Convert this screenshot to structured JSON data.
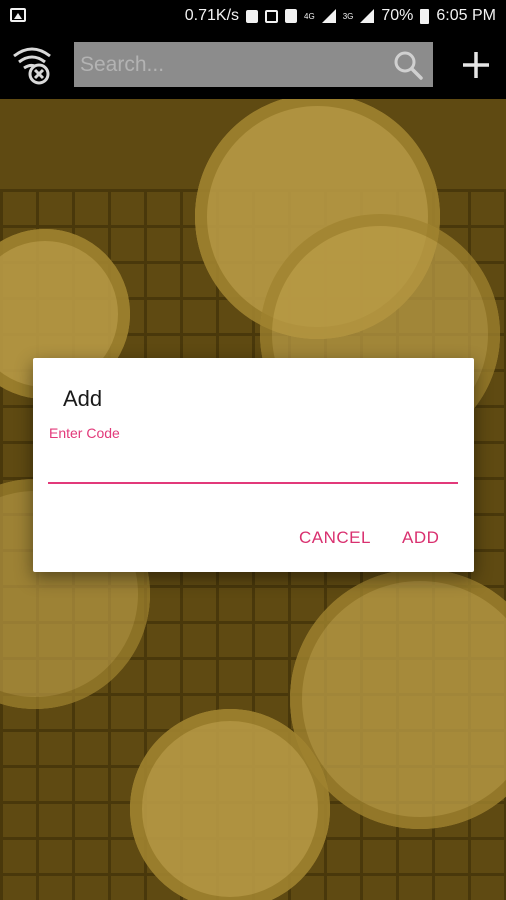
{
  "status_bar": {
    "speed": "0.71K/s",
    "network_labels": [
      "4G",
      "3G"
    ],
    "battery": "70%",
    "time": "6:05 PM"
  },
  "top_bar": {
    "search_placeholder": "Search...",
    "icons": [
      "wifi-off-icon",
      "search-icon",
      "plus-icon"
    ]
  },
  "dialog": {
    "title": "Add",
    "field_label": "Enter Code",
    "field_value": "",
    "cancel_label": "CANCEL",
    "add_label": "ADD"
  },
  "colors": {
    "accent": "#e2397a",
    "toolbar": "#000000",
    "search_box": "#8c8c8c",
    "background_tint": "#5f4a12"
  }
}
